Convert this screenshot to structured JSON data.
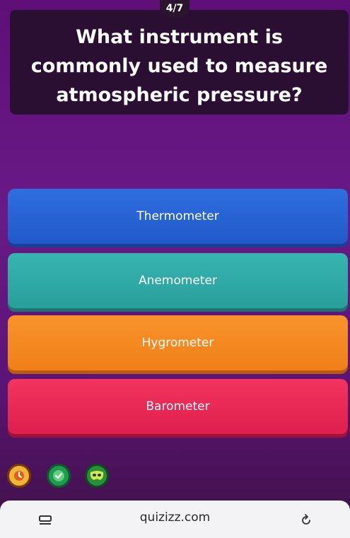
{
  "quiz": {
    "counter": "4/7",
    "question": "What instrument is commonly used to measure atmospheric pressure?",
    "options": [
      {
        "label": "Thermometer",
        "color": "#2159c9"
      },
      {
        "label": "Anemometer",
        "color": "#2a9f9c"
      },
      {
        "label": "Hygrometer",
        "color": "#f07f19"
      },
      {
        "label": "Barometer",
        "color": "#df1f4d"
      }
    ],
    "powerups": [
      {
        "icon": "streak-icon"
      },
      {
        "icon": "checkmark-powerup-icon"
      },
      {
        "icon": "mask-powerup-icon"
      }
    ]
  },
  "browser": {
    "url": "quizizz.com",
    "left_icon": "tabs-icon",
    "right_icon": "reload-icon"
  },
  "colors": {
    "background": "#5e0f78",
    "question_card": "#2a0f33"
  }
}
